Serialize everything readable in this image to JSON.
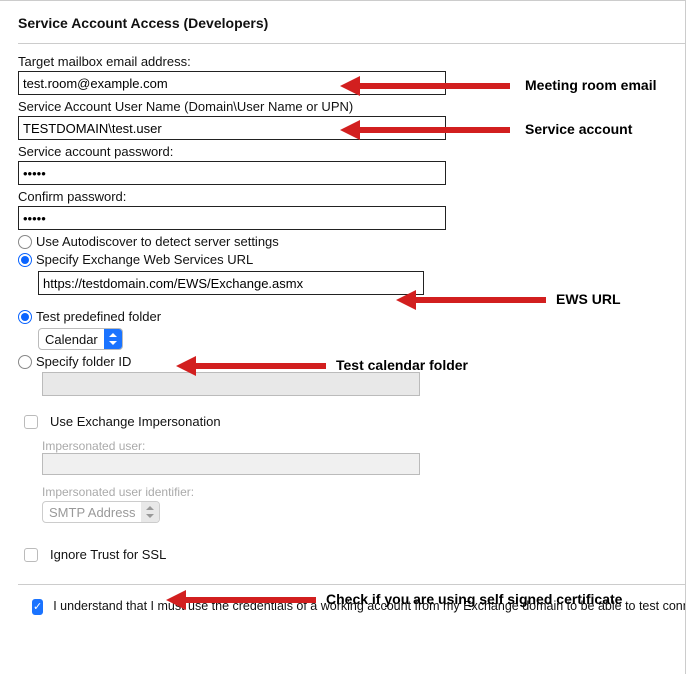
{
  "title": "Service Account Access (Developers)",
  "fields": {
    "target_label": "Target mailbox email address:",
    "target_value": "test.room@example.com",
    "svc_user_label": "Service Account User Name (Domain\\User Name or UPN)",
    "svc_user_value": "TESTDOMAIN\\test.user",
    "svc_pwd_label": "Service account password:",
    "svc_pwd_value": "•••••",
    "confirm_pwd_label": "Confirm password:",
    "confirm_pwd_value": "•••••"
  },
  "server": {
    "autodiscover_label": "Use Autodiscover to detect server settings",
    "specify_url_label": "Specify Exchange Web Services URL",
    "url_value": "https://testdomain.com/EWS/Exchange.asmx"
  },
  "folder": {
    "predef_label": "Test predefined folder",
    "predef_selected": "Calendar",
    "specify_id_label": "Specify folder ID"
  },
  "impersonation": {
    "use_label": "Use Exchange Impersonation",
    "imp_user_label": "Impersonated user:",
    "imp_id_label": "Impersonated user identifier:",
    "imp_id_selected": "SMTP Address"
  },
  "ssl": {
    "ignore_label": "Ignore Trust for SSL"
  },
  "ack": {
    "text": "I understand that I must use the credentials of a working account from my Exchange domain to be able to test connectivity to it i"
  },
  "annotations": {
    "a1": "Meeting room email",
    "a2": "Service account",
    "a3": "EWS URL",
    "a4": "Test calendar folder",
    "a5": "Check if you are using self signed certificate"
  }
}
